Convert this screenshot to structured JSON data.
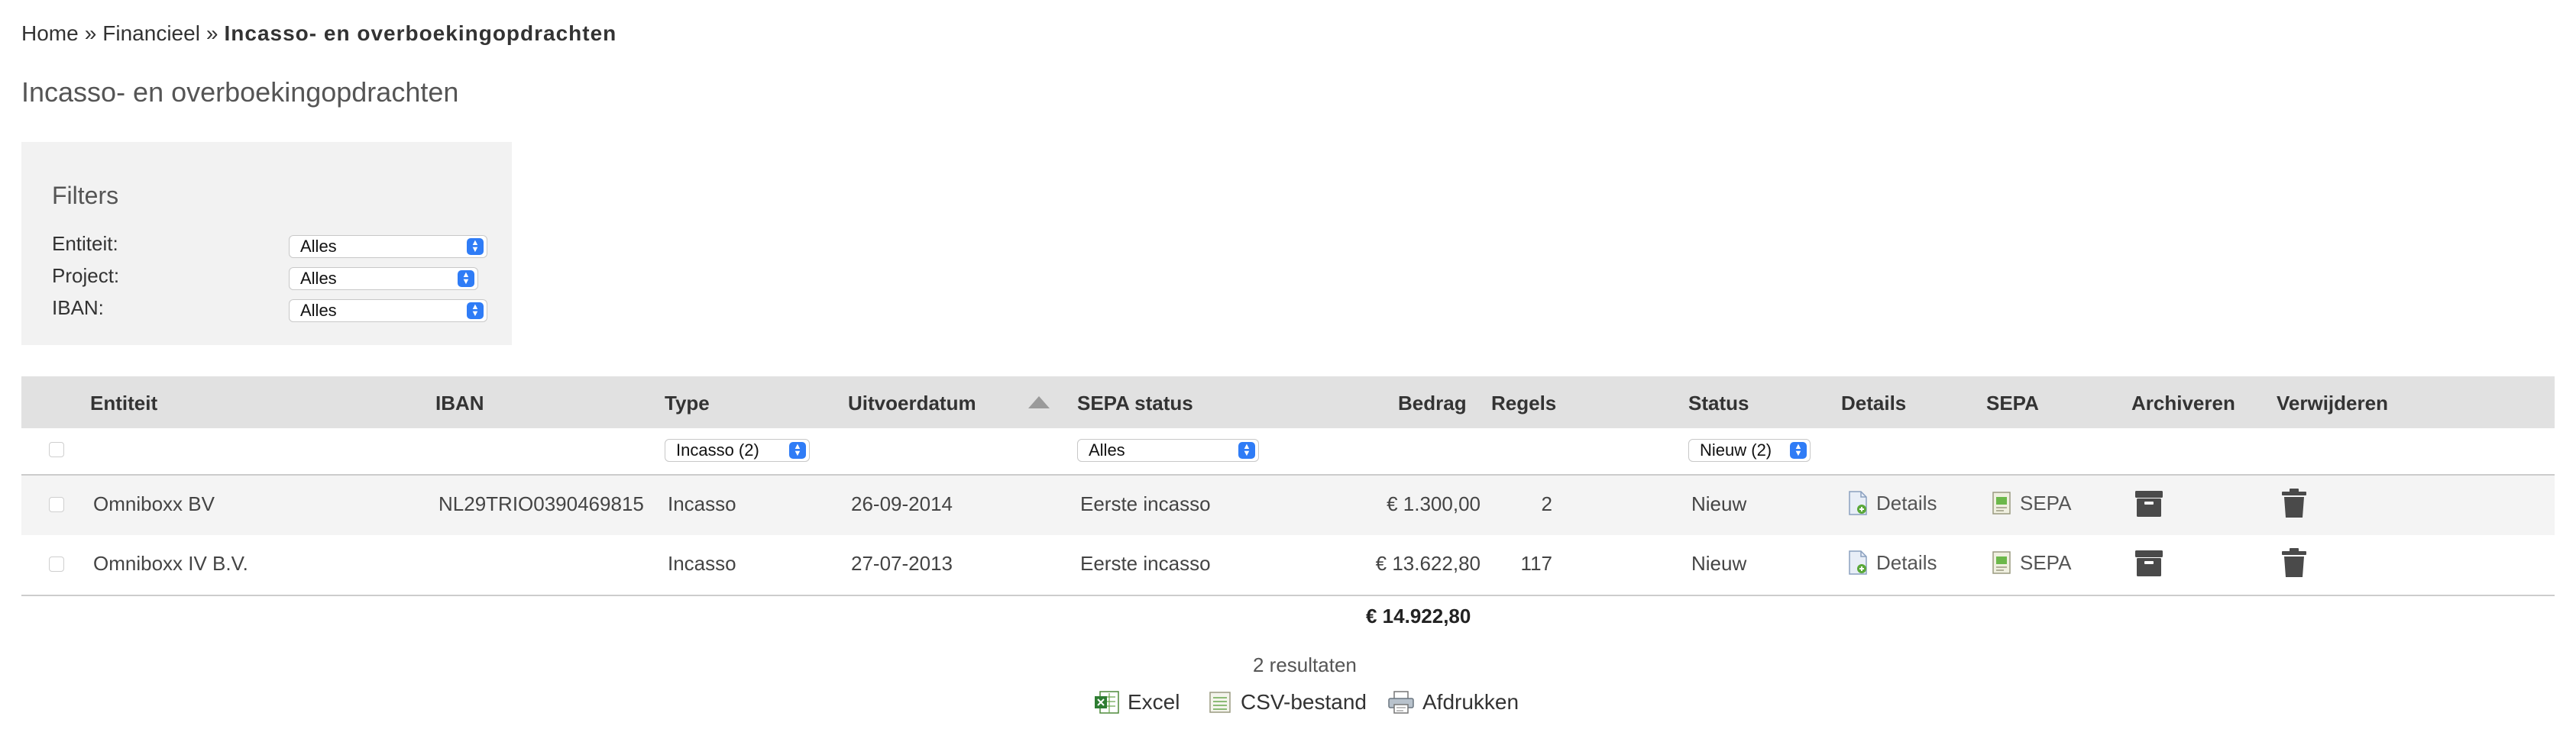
{
  "breadcrumb": {
    "home": "Home",
    "separator": "»",
    "financial": "Financieel",
    "current": "Incasso- en overboekingopdrachten"
  },
  "page_title": "Incasso- en overboekingopdrachten",
  "filters": {
    "title": "Filters",
    "entity_label": "Entiteit:",
    "entity_value": "Alles",
    "project_label": "Project:",
    "project_value": "Alles",
    "iban_label": "IBAN:",
    "iban_value": "Alles"
  },
  "table": {
    "headers": {
      "entity": "Entiteit",
      "iban": "IBAN",
      "type": "Type",
      "date": "Uitvoerdatum",
      "sepa_status": "SEPA status",
      "amount": "Bedrag",
      "lines": "Regels",
      "status": "Status",
      "details": "Details",
      "sepa": "SEPA",
      "archive": "Archiveren",
      "delete": "Verwijderen"
    },
    "column_filters": {
      "type": "Incasso (2)",
      "sepa_status": "Alles",
      "status": "Nieuw (2)"
    },
    "rows": [
      {
        "entity": "Omniboxx BV",
        "iban": "NL29TRIO0390469815",
        "type": "Incasso",
        "date": "26-09-2014",
        "sepa_status": "Eerste incasso",
        "amount": "€ 1.300,00",
        "lines": "2",
        "status": "Nieuw",
        "details_label": "Details",
        "sepa_label": "SEPA"
      },
      {
        "entity": "Omniboxx IV B.V.",
        "iban": "",
        "type": "Incasso",
        "date": "27-07-2013",
        "sepa_status": "Eerste incasso",
        "amount": "€ 13.622,80",
        "lines": "117",
        "status": "Nieuw",
        "details_label": "Details",
        "sepa_label": "SEPA"
      }
    ],
    "total": "€ 14.922,80",
    "results": "2 resultaten"
  },
  "exports": {
    "excel": "Excel",
    "csv": "CSV-bestand",
    "print": "Afdrukken"
  },
  "colors": {
    "select_accent": "#2f7cf6",
    "header_bg": "#e1e1e1",
    "filter_panel_bg": "#f2f2f2",
    "striped_row_bg": "#f4f4f4"
  },
  "icons": {
    "details": "details-document-icon",
    "sepa": "sepa-document-icon",
    "archive": "archive-box-icon",
    "delete": "trash-icon",
    "excel": "excel-icon",
    "csv": "csv-file-icon",
    "print": "printer-icon"
  }
}
